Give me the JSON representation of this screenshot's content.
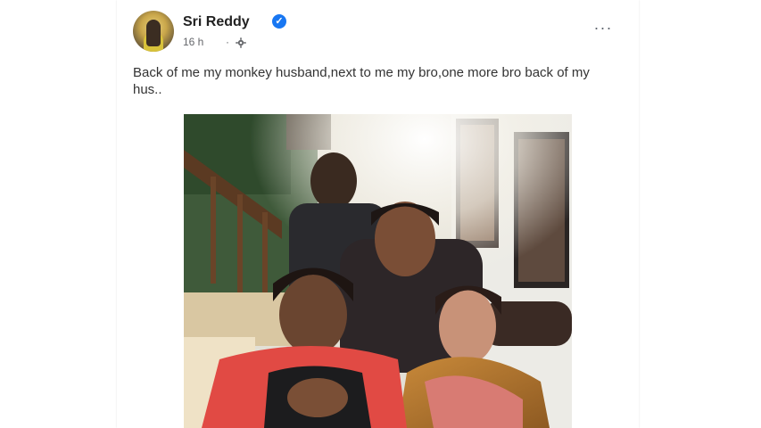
{
  "post": {
    "author": {
      "name": "Sri Reddy",
      "verified": true,
      "avatar": "profile-avatar"
    },
    "time": "16 h",
    "separator": "·",
    "audience_icon": "gear-icon",
    "more_icon": "more-options-icon",
    "more_glyph": "···",
    "caption": "Back of me my monkey husband,next to me my bro,one more bro back of my hus..",
    "photo": {
      "description_icon": "group-photo-image"
    }
  },
  "colors": {
    "verified_badge": "#1877f2",
    "author_text": "#222222",
    "meta_text": "#65676b"
  }
}
